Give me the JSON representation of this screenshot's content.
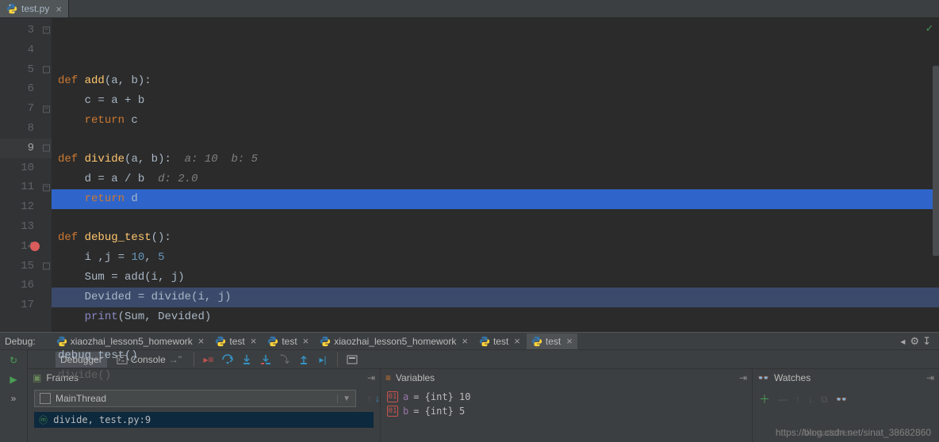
{
  "editor": {
    "tab_name": "test.py",
    "check_ok": "✓",
    "lines": [
      {
        "n": 3,
        "indent": 0,
        "fold": "-",
        "tokens": [
          [
            "kw",
            "def "
          ],
          [
            "fn",
            "add"
          ],
          [
            "op",
            "("
          ],
          [
            "param",
            "a"
          ],
          [
            "op",
            ", "
          ],
          [
            "param",
            "b"
          ],
          [
            "op",
            "):"
          ]
        ]
      },
      {
        "n": 4,
        "indent": 1,
        "tokens": [
          [
            "ident",
            "c "
          ],
          [
            "op",
            "= "
          ],
          [
            "ident",
            "a "
          ],
          [
            "op",
            "+ "
          ],
          [
            "ident",
            "b"
          ]
        ]
      },
      {
        "n": 5,
        "indent": 1,
        "fold": "e",
        "tokens": [
          [
            "kw",
            "return "
          ],
          [
            "ident",
            "c"
          ]
        ]
      },
      {
        "n": 6,
        "indent": 0,
        "tokens": []
      },
      {
        "n": 7,
        "indent": 0,
        "fold": "-",
        "tokens": [
          [
            "kw",
            "def "
          ],
          [
            "fn",
            "divide"
          ],
          [
            "op",
            "("
          ],
          [
            "param",
            "a"
          ],
          [
            "op",
            ", "
          ],
          [
            "param",
            "b"
          ],
          [
            "op",
            "):  "
          ],
          [
            "hint",
            "a: 10  b: 5"
          ]
        ]
      },
      {
        "n": 8,
        "indent": 1,
        "tokens": [
          [
            "ident",
            "d "
          ],
          [
            "op",
            "= "
          ],
          [
            "ident",
            "a "
          ],
          [
            "op",
            "/ "
          ],
          [
            "ident",
            "b  "
          ],
          [
            "hint",
            "d: 2.0"
          ]
        ]
      },
      {
        "n": 9,
        "indent": 1,
        "fold": "e",
        "hl": "exec",
        "tokens": [
          [
            "kw",
            "return "
          ],
          [
            "ident",
            "d"
          ]
        ]
      },
      {
        "n": 10,
        "indent": 0,
        "tokens": []
      },
      {
        "n": 11,
        "indent": 0,
        "fold": "-",
        "tokens": [
          [
            "kw",
            "def "
          ],
          [
            "fn",
            "debug_test"
          ],
          [
            "op",
            "():"
          ]
        ]
      },
      {
        "n": 12,
        "indent": 1,
        "tokens": [
          [
            "ident",
            "i "
          ],
          [
            "op",
            ","
          ],
          [
            "ident",
            "j "
          ],
          [
            "op",
            "= "
          ],
          [
            "num",
            "10"
          ],
          [
            "op",
            ", "
          ],
          [
            "num",
            "5"
          ]
        ]
      },
      {
        "n": 13,
        "indent": 1,
        "tokens": [
          [
            "ident",
            "Sum "
          ],
          [
            "op",
            "= "
          ],
          [
            "ident",
            "add"
          ],
          [
            "op",
            "("
          ],
          [
            "ident",
            "i"
          ],
          [
            "op",
            ", "
          ],
          [
            "ident",
            "j"
          ],
          [
            "op",
            ")"
          ]
        ]
      },
      {
        "n": 14,
        "indent": 1,
        "hl": "stack",
        "bp": true,
        "tokens": [
          [
            "ident",
            "Devided "
          ],
          [
            "op",
            "= "
          ],
          [
            "ident",
            "divide"
          ],
          [
            "op",
            "("
          ],
          [
            "ident",
            "i"
          ],
          [
            "op",
            ", "
          ],
          [
            "ident",
            "j"
          ],
          [
            "op",
            ")"
          ]
        ]
      },
      {
        "n": 15,
        "indent": 1,
        "fold": "e",
        "tokens": [
          [
            "builtin",
            "print"
          ],
          [
            "op",
            "("
          ],
          [
            "ident",
            "Sum"
          ],
          [
            "op",
            ", "
          ],
          [
            "ident",
            "Devided"
          ],
          [
            "op",
            ")"
          ]
        ]
      },
      {
        "n": 16,
        "indent": 0,
        "tokens": []
      },
      {
        "n": 17,
        "indent": 0,
        "tokens": [
          [
            "ident",
            "debug_test"
          ],
          [
            "op",
            "()"
          ]
        ]
      }
    ],
    "suggest": "divide()"
  },
  "debug": {
    "label": "Debug:",
    "tabs": [
      {
        "name": "xiaozhai_lesson5_homework",
        "active": false
      },
      {
        "name": "test",
        "active": false
      },
      {
        "name": "test",
        "active": false
      },
      {
        "name": "xiaozhai_lesson5_homework",
        "active": false
      },
      {
        "name": "test",
        "active": false
      },
      {
        "name": "test",
        "active": true
      }
    ],
    "subtabs": {
      "debugger": "Debugger",
      "console": "Console"
    },
    "frames_label": "Frames",
    "thread": "MainThread",
    "frame": "divide, test.py:9",
    "vars_label": "Variables",
    "vars": [
      {
        "name": "a",
        "val": "{int} 10"
      },
      {
        "name": "b",
        "val": "{int} 5"
      }
    ],
    "watches_label": "Watches",
    "nowatches": "No watches"
  },
  "watermark": "https://blog.csdn.net/sinat_38682860"
}
